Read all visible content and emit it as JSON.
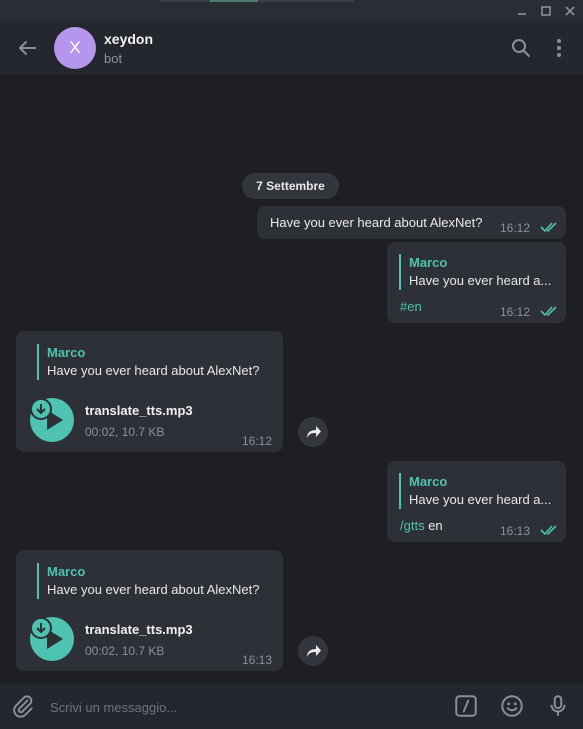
{
  "window": {
    "controls": [
      "minimize-icon",
      "maximize-icon",
      "close-icon"
    ]
  },
  "header": {
    "avatar_letter": "X",
    "chat_name": "xeydon",
    "chat_subtitle": "bot",
    "avatar_color": "#b695ee"
  },
  "chat": {
    "date_label": "7 Settembre",
    "messages": [
      {
        "direction": "outgoing",
        "text": "Have you ever heard about AlexNet?",
        "time": "16:12",
        "status": "read"
      },
      {
        "direction": "outgoing",
        "reply_to_name": "Marco",
        "reply_to_text": "Have you ever heard a...",
        "text": "#en",
        "time": "16:12",
        "status": "read"
      },
      {
        "direction": "incoming",
        "reply_to_name": "Marco",
        "reply_to_text": "Have you ever heard about AlexNet?",
        "file_name": "translate_tts.mp3",
        "file_meta": "00:02, 10.7 KB",
        "time": "16:12"
      },
      {
        "direction": "outgoing",
        "reply_to_name": "Marco",
        "reply_to_text": "Have you ever heard a...",
        "command": "/gtts",
        "text_after_command": " en",
        "time": "16:13",
        "status": "read"
      },
      {
        "direction": "incoming",
        "reply_to_name": "Marco",
        "reply_to_text": "Have you ever heard about AlexNet?",
        "file_name": "translate_tts.mp3",
        "file_meta": "00:02, 10.7 KB",
        "time": "16:13"
      }
    ]
  },
  "composer": {
    "placeholder": "Scrivi un messaggio..."
  },
  "colors": {
    "accent": "#4fc3b1",
    "bubble": "#2d3037",
    "background": "#1e1f23"
  }
}
